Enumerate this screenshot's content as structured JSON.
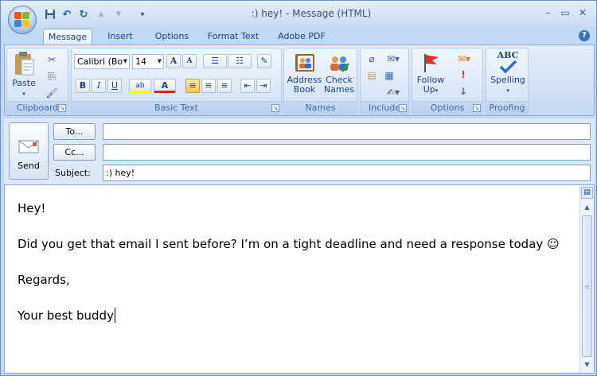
{
  "window": {
    "title": ":) hey!  -  Message (HTML)",
    "controls": {
      "minimize": "–",
      "restore": "▭",
      "close": "✕"
    }
  },
  "quick_access": {
    "save_icon": "save-icon",
    "undo": "↶",
    "redo": "↻",
    "up": "▲",
    "down": "▼",
    "customize": "▾"
  },
  "tabs": [
    {
      "label": "Message",
      "active": true
    },
    {
      "label": "Insert"
    },
    {
      "label": "Options"
    },
    {
      "label": "Format Text"
    },
    {
      "label": "Adobe PDF"
    }
  ],
  "help": "?",
  "ribbon": {
    "clipboard": {
      "label": "Clipboard",
      "paste": "Paste",
      "paste_arrow": "▾",
      "cut": "✂",
      "copy": "⎘",
      "format_painter": "🖌"
    },
    "basic_text": {
      "label": "Basic Text",
      "font": "Calibri (Bo",
      "size": "14",
      "grow": "A",
      "shrink": "A",
      "bold": "B",
      "italic": "I",
      "underline": "U",
      "highlight": "ab",
      "font_color": "A",
      "bullets": "☰",
      "numbering": "☷",
      "clear": "✎",
      "align_left": "≡",
      "align_center": "≡",
      "align_right": "≡",
      "outdent": "⇤",
      "indent": "⇥"
    },
    "names": {
      "label": "Names",
      "address_book_line1": "Address",
      "address_book_line2": "Book",
      "check_names_line1": "Check",
      "check_names_line2": "Names"
    },
    "include": {
      "label": "Include"
    },
    "options": {
      "label": "Options",
      "follow_up_line1": "Follow",
      "follow_up_line2": "Up",
      "follow_up_arrow": "▾"
    },
    "proofing": {
      "label": "Proofing",
      "spelling": "Spelling",
      "abc": "ABC",
      "arrow": "▾"
    }
  },
  "header": {
    "send": "Send",
    "to_button": "To...",
    "cc_button": "Cc...",
    "subject_label": "Subject:",
    "to_value": "",
    "cc_value": "",
    "subject_value": ":) hey!"
  },
  "message_body": {
    "line1": "Hey!",
    "line2": "Did you get that email I sent before? I’m on a tight deadline and need a response today ☺",
    "line3": "Regards,",
    "line4": "Your best buddy"
  },
  "colors": {
    "accent": "#15428b",
    "ribbon": "#dbe7f8",
    "highlight": "#f7c55a"
  }
}
